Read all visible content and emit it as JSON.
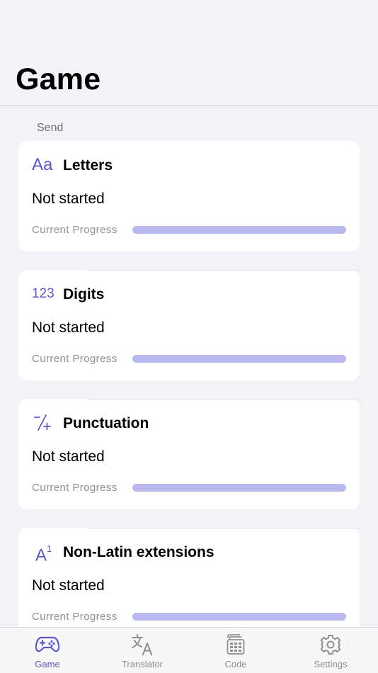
{
  "nav": {
    "title": "Game"
  },
  "section": {
    "header": "Send"
  },
  "cards": [
    {
      "icon_name": "letters-aa-icon",
      "icon_text": "Aa",
      "title": "Letters",
      "status": "Not started",
      "progress_label": "Current Progress",
      "progress": 0
    },
    {
      "icon_name": "digits-123-icon",
      "icon_text": "123",
      "title": "Digits",
      "status": "Not started",
      "progress_label": "Current Progress",
      "progress": 0
    },
    {
      "icon_name": "plus-slash-minus-icon",
      "icon_text": "",
      "title": "Punctuation",
      "status": "Not started",
      "progress_label": "Current Progress",
      "progress": 0
    },
    {
      "icon_name": "character-superscript-icon",
      "icon_text": "A",
      "icon_sup": "1",
      "title": "Non-Latin extensions",
      "status": "Not started",
      "progress_label": "Current Progress",
      "progress": 0
    }
  ],
  "tabbar": {
    "items": [
      {
        "label": "Game",
        "icon": "gamecontroller-icon",
        "active": true
      },
      {
        "label": "Translator",
        "icon": "translate-icon",
        "active": false
      },
      {
        "label": "Code",
        "icon": "keyboard-grid-icon",
        "active": false
      },
      {
        "label": "Settings",
        "icon": "gear-icon",
        "active": false
      }
    ]
  },
  "colors": {
    "accent": "#5b58c9",
    "progress_track": "#b9b8ef",
    "background": "#f2f2f7",
    "card": "#ffffff",
    "secondary_text": "#8e8e93"
  }
}
